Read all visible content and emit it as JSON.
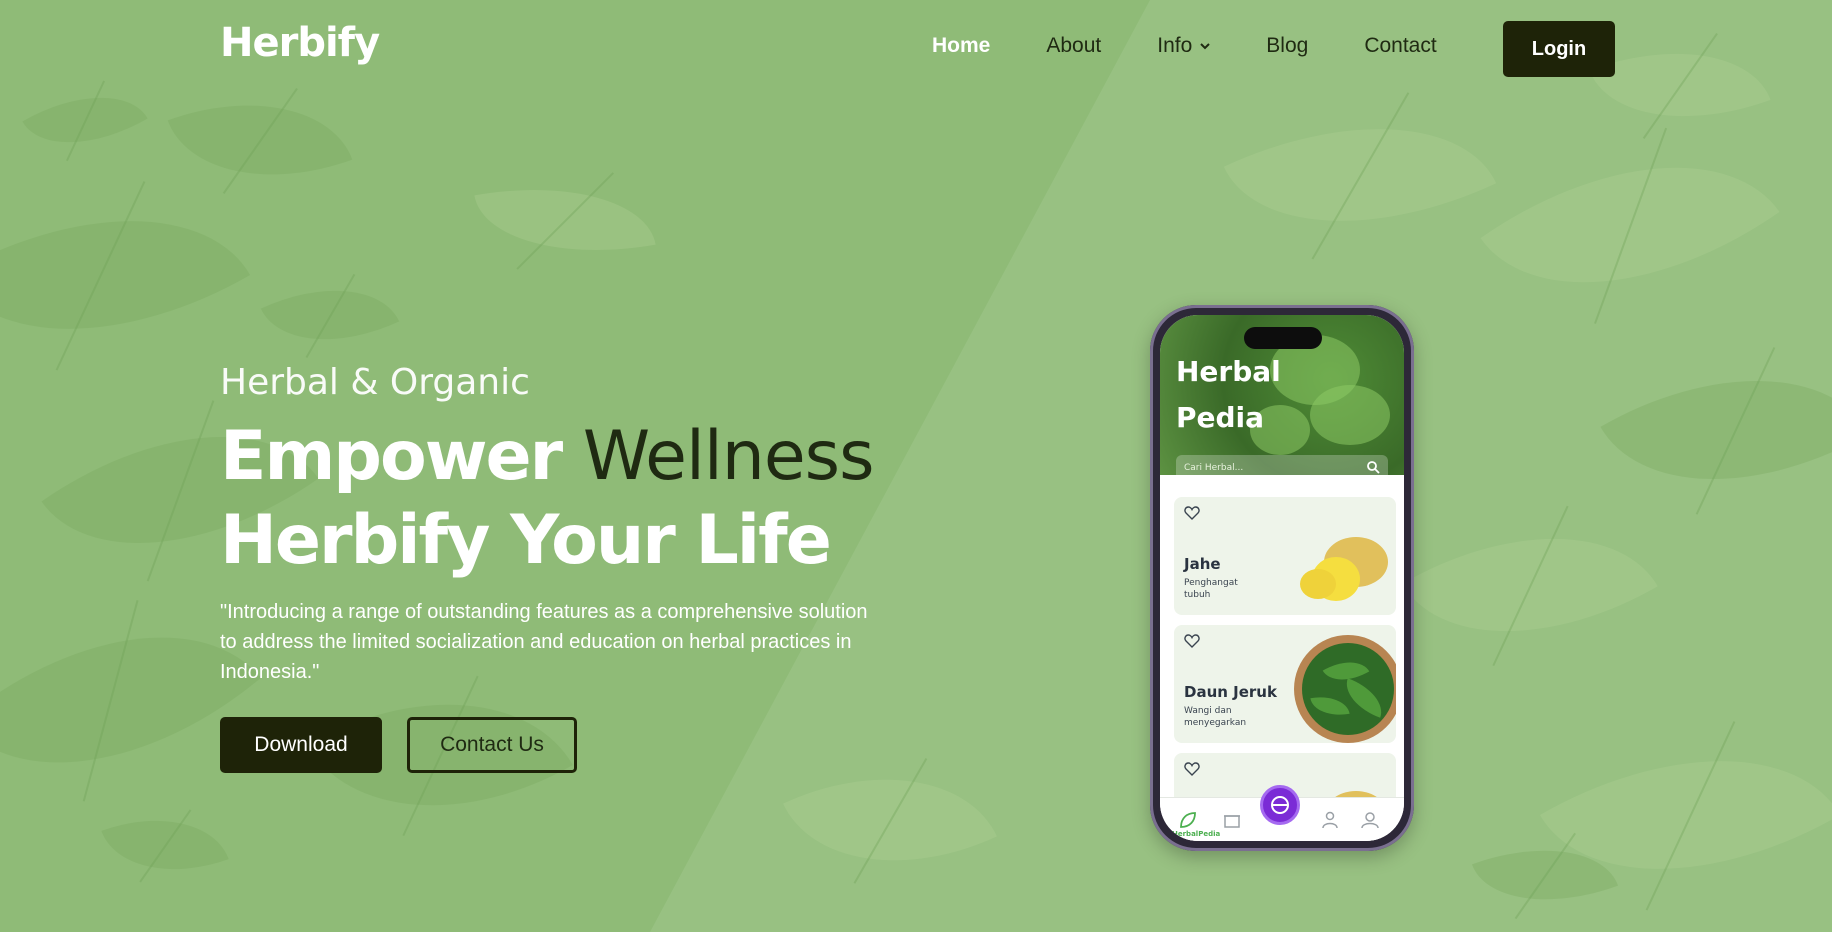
{
  "brand": {
    "name": "Herbify"
  },
  "nav": {
    "items": [
      {
        "label": "Home",
        "active": true
      },
      {
        "label": "About",
        "active": false
      },
      {
        "label": "Info",
        "active": false,
        "has_dropdown": true
      },
      {
        "label": "Blog",
        "active": false
      },
      {
        "label": "Contact",
        "active": false
      }
    ],
    "login_label": "Login"
  },
  "hero": {
    "subtitle": "Herbal & Organic",
    "headline_line1_bold": "Empower",
    "headline_line1_thin": "Wellness",
    "headline_line2": "Herbify Your Life",
    "description": "\"Introducing a range of outstanding features as a comprehensive solution to address the limited socialization and education on herbal practices in Indonesia.\"",
    "download_label": "Download",
    "contact_label": "Contact Us"
  },
  "phone": {
    "app_title_line1": "Herbal",
    "app_title_line2": "Pedia",
    "search_placeholder": "Cari Herbal...",
    "cards": [
      {
        "name": "Jahe",
        "desc": "Penghangat tubuh",
        "image": "ginger"
      },
      {
        "name": "Daun Jeruk",
        "desc": "Wangi dan menyegarkan",
        "image": "lime-leaves"
      },
      {
        "name": "",
        "desc": "",
        "image": "ginger"
      }
    ],
    "bottom_nav_label": "HerbalPedia",
    "bottom_nav_icons": [
      "leaf-icon",
      "store-icon",
      "scan-icon",
      "doctor-icon",
      "profile-icon"
    ]
  },
  "colors": {
    "background": "#8fbb77",
    "dark_button": "#1e2308",
    "white_text": "#ffffff",
    "dark_text": "#1f2a12",
    "fab": "#7b2bd6"
  }
}
